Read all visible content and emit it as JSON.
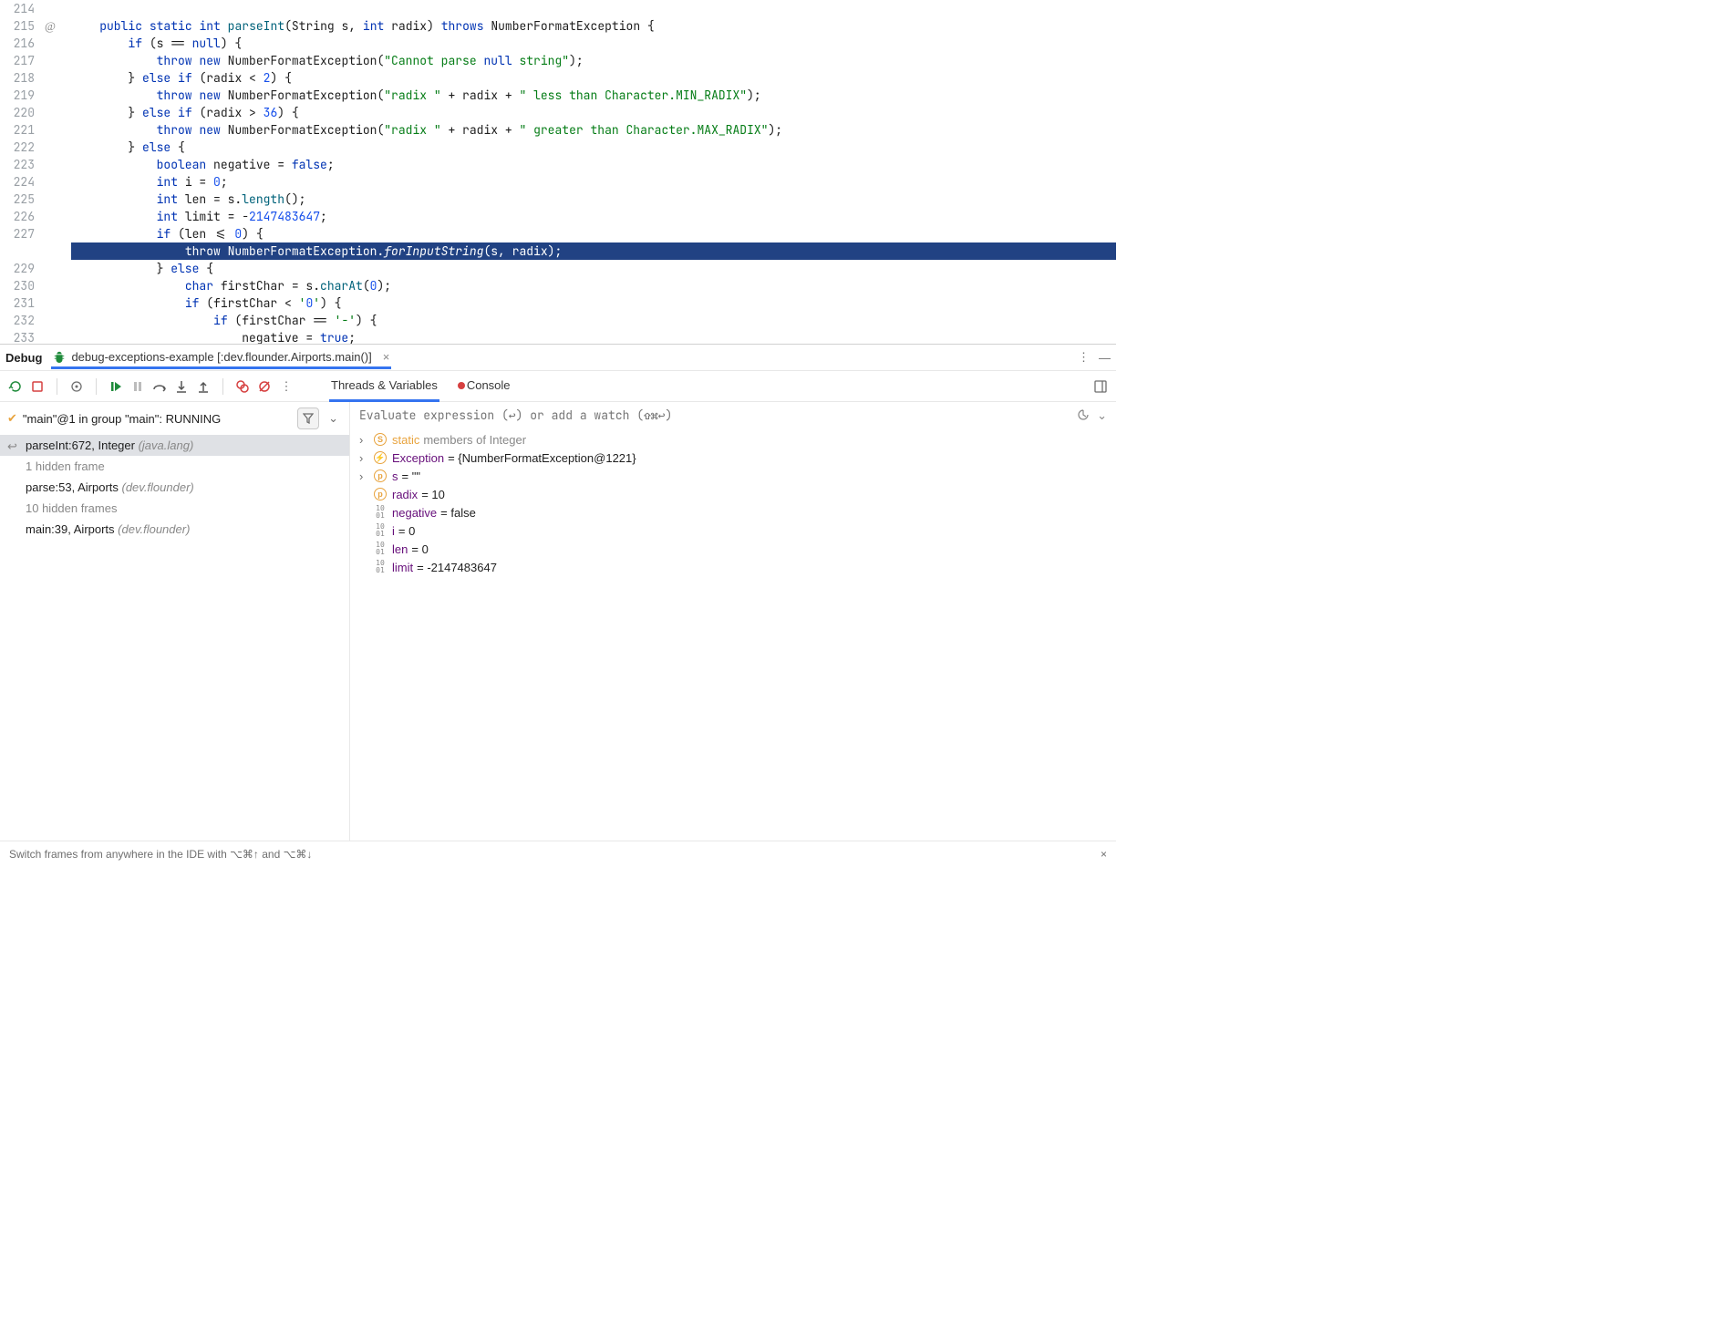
{
  "editor": {
    "lines": [
      {
        "num": "214",
        "code": ""
      },
      {
        "num": "215",
        "icon": "override",
        "code": "    public static int parseInt(String s, int radix) throws NumberFormatException {"
      },
      {
        "num": "216",
        "code": "        if (s == null) {"
      },
      {
        "num": "217",
        "code": "            throw new NumberFormatException(\"Cannot parse null string\");"
      },
      {
        "num": "218",
        "code": "        } else if (radix < 2) {"
      },
      {
        "num": "219",
        "code": "            throw new NumberFormatException(\"radix \" + radix + \" less than Character.MIN_RADIX\");"
      },
      {
        "num": "220",
        "code": "        } else if (radix > 36) {"
      },
      {
        "num": "221",
        "code": "            throw new NumberFormatException(\"radix \" + radix + \" greater than Character.MAX_RADIX\");"
      },
      {
        "num": "222",
        "code": "        } else {"
      },
      {
        "num": "223",
        "code": "            boolean negative = false;"
      },
      {
        "num": "224",
        "code": "            int i = 0;"
      },
      {
        "num": "225",
        "code": "            int len = s.length();"
      },
      {
        "num": "226",
        "code": "            int limit = -2147483647;"
      },
      {
        "num": "227",
        "code": "            if (len <= 0) {"
      },
      {
        "num": "",
        "icon": "bolt",
        "hl": true,
        "code": "                throw NumberFormatException.forInputString(s, radix);"
      },
      {
        "num": "229",
        "code": "            } else {"
      },
      {
        "num": "230",
        "code": "                char firstChar = s.charAt(0);"
      },
      {
        "num": "231",
        "code": "                if (firstChar < '0') {"
      },
      {
        "num": "232",
        "code": "                    if (firstChar == '-') {"
      },
      {
        "num": "233",
        "code": "                        negative = true;"
      }
    ]
  },
  "debug": {
    "title": "Debug",
    "run_config": "debug-exceptions-example [:dev.flounder.Airports.main()]",
    "tabs": {
      "threads": "Threads & Variables",
      "console": "Console"
    },
    "thread_status_prefix": "\"main\"@1 in group \"main\": ",
    "thread_status_state": "RUNNING",
    "frames": [
      {
        "label": "parseInt:672, Integer ",
        "pkg": "(java.lang)",
        "sel": true,
        "ret": true
      },
      {
        "label": "1 hidden frame",
        "hidden": true
      },
      {
        "label": "parse:53, Airports ",
        "pkg": "(dev.flounder)"
      },
      {
        "label": "10 hidden frames",
        "hidden": true
      },
      {
        "label": "main:39, Airports ",
        "pkg": "(dev.flounder)"
      }
    ],
    "eval_placeholder": "Evaluate expression (↩) or add a watch (⇧⌘↩)",
    "vars": [
      {
        "arrow": true,
        "icon": "S",
        "iconColor": "#E8A33D",
        "name": "static",
        "nameColor": "#E8A33D",
        "rest": "members of Integer",
        "restGray": true
      },
      {
        "arrow": true,
        "icon": "⚡",
        "iconColor": "#E8A33D",
        "name": "Exception",
        "nameColor": "#660E7A",
        "rest": "= {NumberFormatException@1221}"
      },
      {
        "arrow": true,
        "icon": "p",
        "iconColor": "#E8A33D",
        "name": "s",
        "nameColor": "#660E7A",
        "rest": "= \"\""
      },
      {
        "arrow": false,
        "icon": "p",
        "iconColor": "#E8A33D",
        "name": "radix",
        "nameColor": "#660E7A",
        "rest": "= 10"
      },
      {
        "arrow": false,
        "icon": "01",
        "iconColor": "#888",
        "name": "negative",
        "nameColor": "#660E7A",
        "rest": "= false"
      },
      {
        "arrow": false,
        "icon": "01",
        "iconColor": "#888",
        "name": "i",
        "nameColor": "#660E7A",
        "rest": "= 0"
      },
      {
        "arrow": false,
        "icon": "01",
        "iconColor": "#888",
        "name": "len",
        "nameColor": "#660E7A",
        "rest": "= 0"
      },
      {
        "arrow": false,
        "icon": "01",
        "iconColor": "#888",
        "name": "limit",
        "nameColor": "#660E7A",
        "rest": "= -2147483647"
      }
    ]
  },
  "tip": "Switch frames from anywhere in the IDE with ⌥⌘↑ and ⌥⌘↓"
}
